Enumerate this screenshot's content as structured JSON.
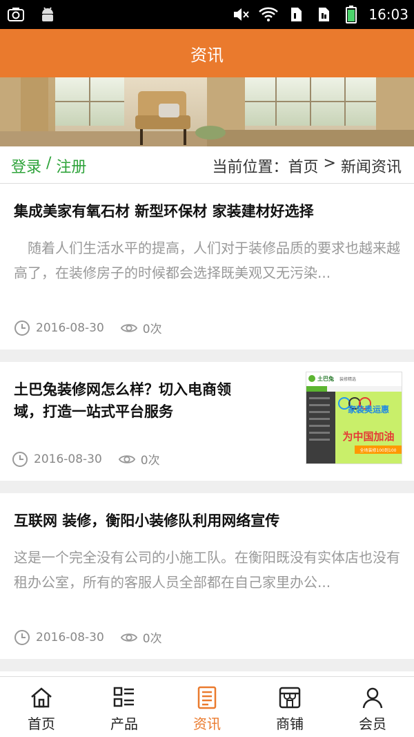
{
  "status_bar": {
    "time": "16:03",
    "icons": [
      "screenshot-icon",
      "android-icon",
      "mute-icon",
      "wifi-icon",
      "sim1-icon",
      "sim2-icon",
      "battery-icon"
    ]
  },
  "header": {
    "title": "资讯"
  },
  "breadcrumb": {
    "login": "登录",
    "separator": " / ",
    "register": "注册",
    "prefix": "当前位置：",
    "home": "首页",
    "arrow": " > ",
    "current": "新闻资讯"
  },
  "articles": [
    {
      "title": "集成美家有氧石材 新型环保材 家装建材好选择",
      "summary": "　随着人们生活水平的提高，人们对于装修品质的要求也越来越高了，在装修房子的时候都会选择既美观又无污染...",
      "date": "2016-08-30",
      "views": "0次"
    },
    {
      "title_lines": [
        "土巴兔装修网怎么样？切入电商领",
        "域，打造一站式平台服务"
      ],
      "date": "2016-08-30",
      "views": "0次",
      "thumbnail": {
        "brand": "土巴兔",
        "badge": "装修精选",
        "promo_top": "家装奥运惠",
        "promo_main": "为中国加油",
        "promo_sub": "全场装修100到100"
      }
    },
    {
      "title": "互联网 装修，衡阳小装修队利用网络宣传",
      "summary": "这是一个完全没有公司的小施工队。在衡阳既没有实体店也没有租办公室，所有的客服人员全部都在自己家里办公...",
      "date": "2016-08-30",
      "views": "0次"
    }
  ],
  "tabs": [
    {
      "label": "首页",
      "icon": "home-icon"
    },
    {
      "label": "产品",
      "icon": "product-list-icon"
    },
    {
      "label": "资讯",
      "icon": "news-icon",
      "active": true
    },
    {
      "label": "商铺",
      "icon": "shop-icon"
    },
    {
      "label": "会员",
      "icon": "member-icon"
    }
  ],
  "colors": {
    "accent": "#ea7a2d",
    "login_green": "#2ea33a"
  }
}
